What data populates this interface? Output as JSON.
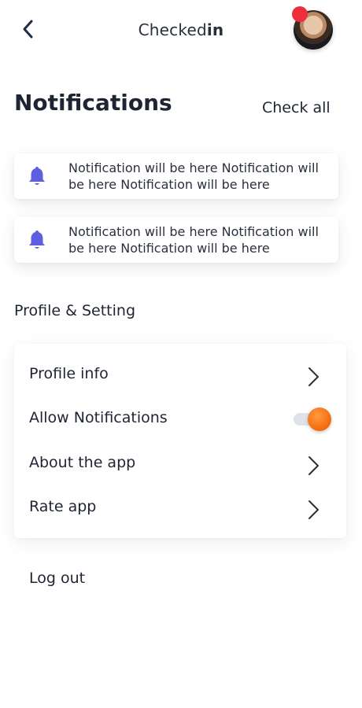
{
  "header": {
    "brand_regular": "Checked",
    "brand_bold": "in",
    "colors": {
      "notification_dot": "#ee2d3d"
    }
  },
  "notifications": {
    "title": "Notifications",
    "check_all": "Check all",
    "items": [
      {
        "text": "Notification will be here Notification will be here Notification will be here",
        "icon": "bell-icon"
      },
      {
        "text": "Notification will be here Notification will be here Notification will be here",
        "icon": "bell-icon"
      }
    ],
    "colors": {
      "bell": "#5b5fe0"
    }
  },
  "settings": {
    "title": "Profile & Setting",
    "items": [
      {
        "label": "Profile info",
        "control": "chevron-right-icon"
      },
      {
        "label": "Allow Notifications",
        "control": "toggle",
        "enabled": true
      },
      {
        "label": "About the app",
        "control": "chevron-right-icon"
      },
      {
        "label": "Rate app",
        "control": "chevron-right-icon"
      }
    ],
    "colors": {
      "toggle_on": "#f36a0d"
    }
  },
  "logout_label": "Log out"
}
